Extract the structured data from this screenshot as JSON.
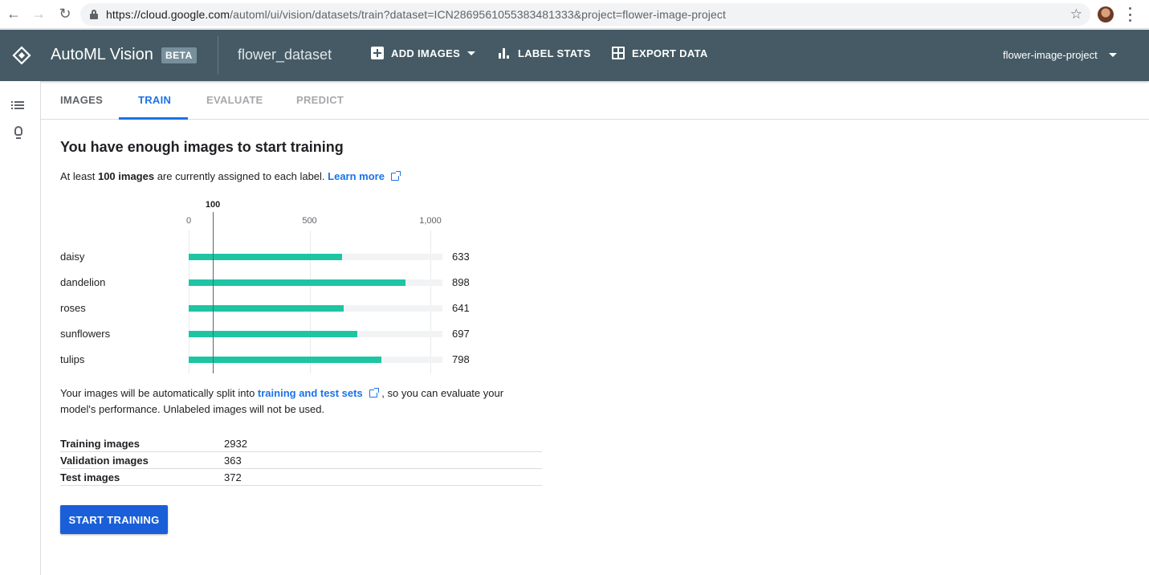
{
  "browser": {
    "url_host": "https://cloud.google.com",
    "url_path": "/automl/ui/vision/datasets/train?dataset=ICN2869561055383481333&project=flower-image-project"
  },
  "header": {
    "app_title": "AutoML Vision",
    "badge": "BETA",
    "dataset": "flower_dataset",
    "add_images": "ADD IMAGES",
    "label_stats": "LABEL STATS",
    "export_data": "EXPORT DATA",
    "project": "flower-image-project",
    "bg_color": "#455a64"
  },
  "tabs": [
    {
      "label": "IMAGES",
      "state": "normal"
    },
    {
      "label": "TRAIN",
      "state": "active"
    },
    {
      "label": "EVALUATE",
      "state": "disabled"
    },
    {
      "label": "PREDICT",
      "state": "disabled"
    }
  ],
  "main": {
    "heading": "You have enough images to start training",
    "sub_prefix": "At least ",
    "sub_bold": "100 images",
    "sub_suffix": " are currently assigned to each label. ",
    "learn_more": "Learn more",
    "split_prefix": "Your images will be automatically split into ",
    "split_link": "training and test sets",
    "split_suffix": " , so you can evaluate your model's performance. Unlabeled images will not be used.",
    "start_button": "START TRAINING"
  },
  "chart_data": {
    "type": "bar",
    "orientation": "horizontal",
    "categories": [
      "daisy",
      "dandelion",
      "roses",
      "sunflowers",
      "tulips"
    ],
    "values": [
      633,
      898,
      641,
      697,
      798
    ],
    "value_labels": [
      "633",
      "898",
      "641",
      "697",
      "798"
    ],
    "xlim": [
      0,
      1050
    ],
    "ticks": [
      0,
      500,
      1000
    ],
    "tick_labels": [
      "0",
      "500",
      "1,000"
    ],
    "threshold": 100,
    "threshold_label": "100",
    "bar_color": "#1dc5a2",
    "grid": true
  },
  "split_stats": [
    {
      "label": "Training images",
      "value": "2932"
    },
    {
      "label": "Validation images",
      "value": "363"
    },
    {
      "label": "Test images",
      "value": "372"
    }
  ]
}
